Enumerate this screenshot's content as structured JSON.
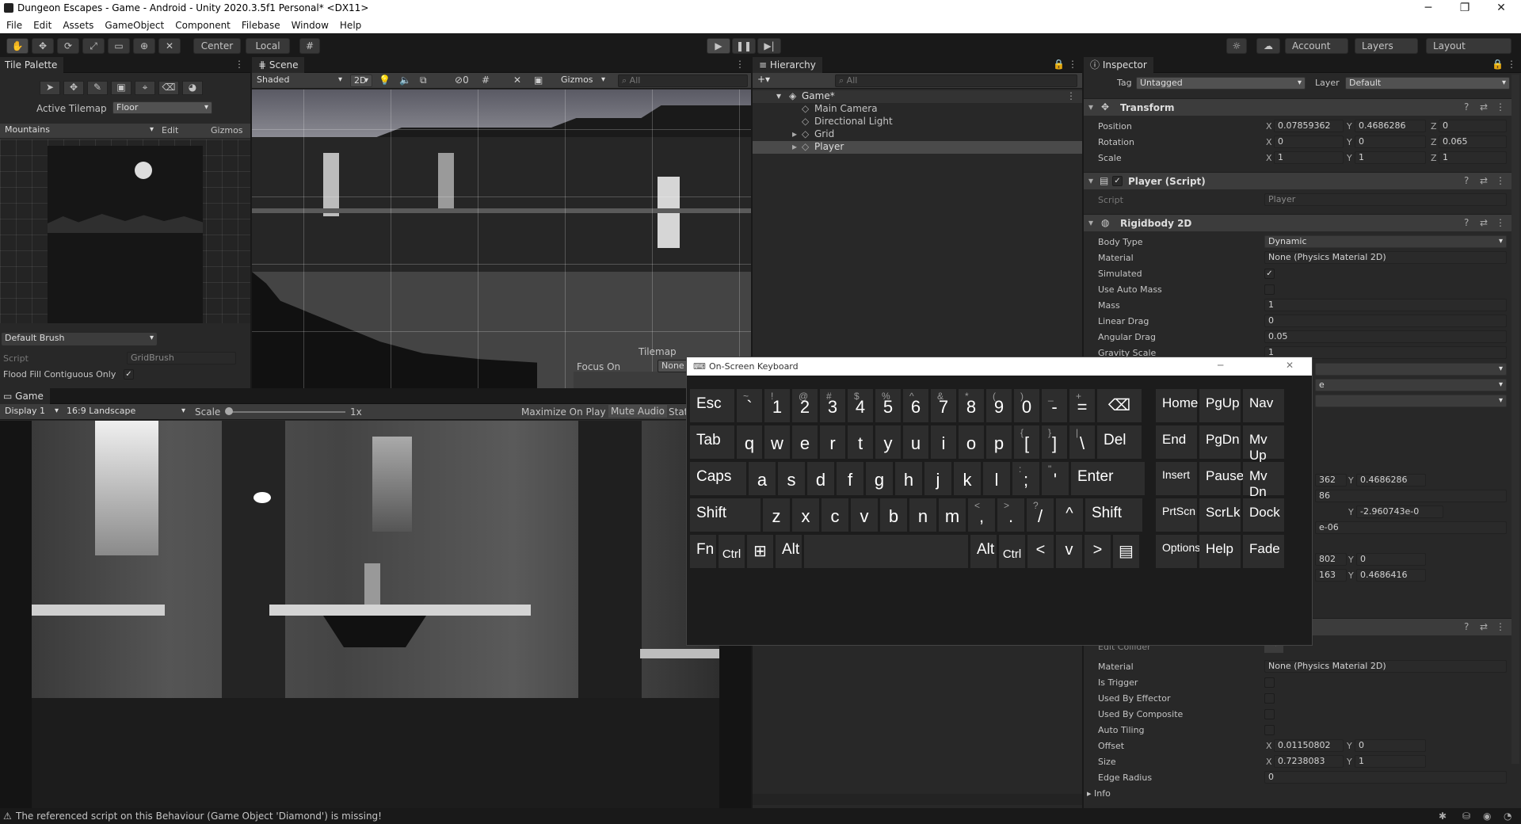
{
  "window": {
    "title": "Dungeon Escapes - Game - Android - Unity 2020.3.5f1 Personal* <DX11>",
    "minimize": "─",
    "maximize": "❐",
    "close": "✕"
  },
  "menu": [
    "File",
    "Edit",
    "Assets",
    "GameObject",
    "Component",
    "Filebase",
    "Window",
    "Help"
  ],
  "toolbar": {
    "center": "Center",
    "local": "Local",
    "account": "Account",
    "layers": "Layers",
    "layout": "Layout"
  },
  "tile_palette": {
    "tab": "Tile Palette",
    "active_tilemap_label": "Active Tilemap",
    "active_tilemap": "Floor",
    "palette": "Mountains",
    "edit": "Edit",
    "gizmos": "Gizmos",
    "brush": "Default Brush",
    "script_label": "Script",
    "script_value": "GridBrush",
    "flood_label": "Flood Fill Contiguous Only"
  },
  "scene": {
    "tab": "Scene",
    "shading": "Shaded",
    "mode_2d": "2D",
    "hidden_count": "0",
    "gizmos": "Gizmos",
    "search": "All",
    "overlay_title": "Tilemap",
    "focus_label": "Focus On",
    "focus_value": "None"
  },
  "game": {
    "tab": "Game",
    "display": "Display 1",
    "aspect": "16:9 Landscape",
    "scale_label": "Scale",
    "scale_value": "1x",
    "maximize": "Maximize On Play",
    "mute": "Mute Audio",
    "stats": "Stats"
  },
  "hierarchy": {
    "tab": "Hierarchy",
    "search": "All",
    "root": "Game*",
    "items": [
      "Main Camera",
      "Directional Light",
      "Grid",
      "Player"
    ]
  },
  "inspector": {
    "tab": "Inspector",
    "tag_label": "Tag",
    "tag": "Untagged",
    "layer_label": "Layer",
    "layer": "Default",
    "transform": {
      "title": "Transform",
      "rows": [
        {
          "label": "Position",
          "x": "0.07859362",
          "y": "0.4686286",
          "z": "0"
        },
        {
          "label": "Rotation",
          "x": "0",
          "y": "0",
          "z": "0.065"
        },
        {
          "label": "Scale",
          "x": "1",
          "y": "1",
          "z": "1"
        }
      ]
    },
    "player_script": {
      "title": "Player (Script)",
      "script_label": "Script",
      "script_value": "Player"
    },
    "rigidbody": {
      "title": "Rigidbody 2D",
      "rows": [
        {
          "label": "Body Type",
          "value": "Dynamic"
        },
        {
          "label": "Material",
          "value": "None (Physics Material 2D)"
        },
        {
          "label": "Simulated",
          "value": "✓"
        },
        {
          "label": "Use Auto Mass",
          "value": ""
        },
        {
          "label": "Mass",
          "value": "1"
        },
        {
          "label": "Linear Drag",
          "value": "0"
        },
        {
          "label": "Angular Drag",
          "value": "0.05"
        },
        {
          "label": "Gravity Scale",
          "value": "1"
        }
      ]
    },
    "partial": {
      "dd_e": "e",
      "r1x": "362",
      "r1y": "0.4686286",
      "r2x": "86",
      "r3y": "-2.960743e-0",
      "r4x": "e-06",
      "r5x": "802",
      "r5y": "0",
      "r6x": "163",
      "r6y": "0.4686416"
    },
    "collider": {
      "edit_label": "Edit Collider",
      "rows": [
        {
          "label": "Material",
          "value": "None (Physics Material 2D)"
        },
        {
          "label": "Is Trigger",
          "value": ""
        },
        {
          "label": "Used By Effector",
          "value": ""
        },
        {
          "label": "Used By Composite",
          "value": ""
        },
        {
          "label": "Auto Tiling",
          "value": ""
        }
      ],
      "offset_label": "Offset",
      "offset_x": "0.01150802",
      "offset_y": "0",
      "size_label": "Size",
      "size_x": "0.7238083",
      "size_y": "1",
      "edge_label": "Edge Radius",
      "edge_value": "0",
      "info_label": "Info"
    }
  },
  "axis": {
    "x": "X",
    "y": "Y",
    "z": "Z"
  },
  "keyboard": {
    "title": "On-Screen Keyboard",
    "minimize": "─",
    "close": "✕",
    "row1": [
      {
        "m": "Esc",
        "t": "word"
      },
      {
        "m": "`",
        "s": "~"
      },
      {
        "m": "1",
        "s": "!"
      },
      {
        "m": "2",
        "s": "@"
      },
      {
        "m": "3",
        "s": "#"
      },
      {
        "m": "4",
        "s": "$"
      },
      {
        "m": "5",
        "s": "%"
      },
      {
        "m": "6",
        "s": "^"
      },
      {
        "m": "7",
        "s": "&"
      },
      {
        "m": "8",
        "s": "*"
      },
      {
        "m": "9",
        "s": "("
      },
      {
        "m": "0",
        "s": ")"
      },
      {
        "m": "-",
        "s": "_"
      },
      {
        "m": "=",
        "s": "+"
      },
      {
        "m": "⌫",
        "t": "icon"
      }
    ],
    "row2": [
      {
        "m": "Tab",
        "t": "word"
      },
      {
        "m": "q"
      },
      {
        "m": "w"
      },
      {
        "m": "e"
      },
      {
        "m": "r"
      },
      {
        "m": "t"
      },
      {
        "m": "y"
      },
      {
        "m": "u"
      },
      {
        "m": "i"
      },
      {
        "m": "o"
      },
      {
        "m": "p"
      },
      {
        "m": "[",
        "s": "{"
      },
      {
        "m": "]",
        "s": "}"
      },
      {
        "m": "\\",
        "s": "|"
      },
      {
        "m": "Del",
        "t": "word"
      }
    ],
    "row3": [
      {
        "m": "Caps",
        "t": "word"
      },
      {
        "m": "a"
      },
      {
        "m": "s"
      },
      {
        "m": "d"
      },
      {
        "m": "f"
      },
      {
        "m": "g"
      },
      {
        "m": "h"
      },
      {
        "m": "j"
      },
      {
        "m": "k"
      },
      {
        "m": "l"
      },
      {
        "m": ";",
        "s": ":"
      },
      {
        "m": "'",
        "s": "\""
      },
      {
        "m": "Enter",
        "t": "word"
      }
    ],
    "row4": [
      {
        "m": "Shift",
        "t": "word"
      },
      {
        "m": "z"
      },
      {
        "m": "x"
      },
      {
        "m": "c"
      },
      {
        "m": "v"
      },
      {
        "m": "b"
      },
      {
        "m": "n"
      },
      {
        "m": "m"
      },
      {
        "m": ",",
        "s": "<"
      },
      {
        "m": ".",
        "s": ">"
      },
      {
        "m": "/",
        "s": "?"
      },
      {
        "m": "^",
        "t": "icon"
      },
      {
        "m": "Shift",
        "t": "word"
      }
    ],
    "row5": [
      {
        "m": "Fn",
        "t": "word"
      },
      {
        "m": "Ctrl",
        "t": "small"
      },
      {
        "m": "⊞",
        "t": "icon"
      },
      {
        "m": "Alt",
        "t": "word"
      },
      {
        "m": "",
        "t": "space"
      },
      {
        "m": "Alt",
        "t": "word"
      },
      {
        "m": "Ctrl",
        "t": "small"
      },
      {
        "m": "<",
        "t": "icon"
      },
      {
        "m": "v",
        "t": "icon"
      },
      {
        "m": ">",
        "t": "icon"
      },
      {
        "m": "▤",
        "t": "icon"
      }
    ],
    "nav": [
      [
        "Home",
        "PgUp",
        "Nav"
      ],
      [
        "End",
        "PgDn",
        "Mv Up"
      ],
      [
        "Insert",
        "Pause",
        "Mv Dn"
      ],
      [
        "PrtScn",
        "ScrLk",
        "Dock"
      ],
      [
        "Options",
        "Help",
        "Fade"
      ]
    ]
  },
  "status": {
    "message": "The referenced script on this Behaviour (Game Object 'Diamond') is missing!"
  }
}
